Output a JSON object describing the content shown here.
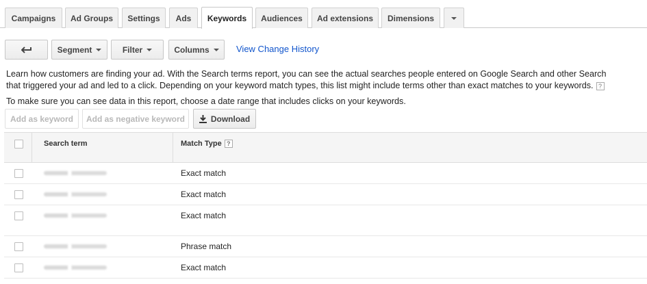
{
  "tabs": [
    {
      "label": "Campaigns",
      "active": false
    },
    {
      "label": "Ad Groups",
      "active": false
    },
    {
      "label": "Settings",
      "active": false
    },
    {
      "label": "Ads",
      "active": false
    },
    {
      "label": "Keywords",
      "active": true
    },
    {
      "label": "Audiences",
      "active": false
    },
    {
      "label": "Ad extensions",
      "active": false
    },
    {
      "label": "Dimensions",
      "active": false
    }
  ],
  "toolbar": {
    "back_icon": "back-arrow-icon",
    "segment_label": "Segment",
    "filter_label": "Filter",
    "columns_label": "Columns",
    "change_history_link": "View Change History"
  },
  "description": {
    "line1": "Learn how customers are finding your ad. With the Search terms report, you can see the actual searches people entered on Google Search and other Search",
    "line2": "that triggered your ad and led to a click. Depending on your keyword match types, this list might include terms other than exact matches to your keywords.",
    "help_glyph": "?",
    "date_hint": "To make sure you can see data in this report, choose a date range that includes clicks on your keywords."
  },
  "actions": {
    "add_keyword": "Add as keyword",
    "add_negative": "Add as negative keyword",
    "download": "Download",
    "download_icon": "download-icon"
  },
  "table": {
    "headers": {
      "search_term": "Search term",
      "match_type": "Match Type",
      "help_glyph": "?"
    },
    "rows": [
      {
        "match_type": "Exact match"
      },
      {
        "match_type": "Exact match"
      },
      {
        "match_type": "Exact match"
      },
      {
        "match_type": "Phrase match"
      },
      {
        "match_type": "Exact match"
      }
    ]
  }
}
